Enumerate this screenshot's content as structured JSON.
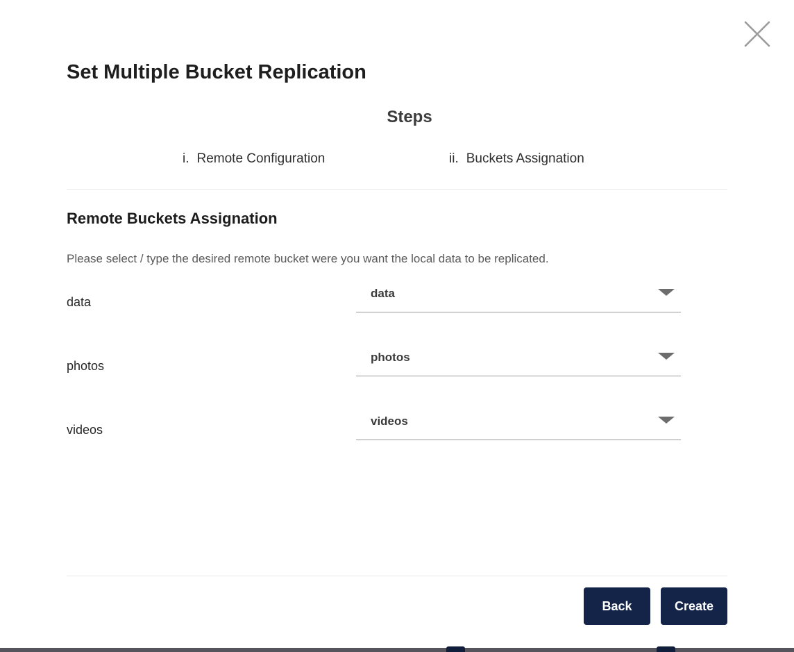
{
  "modal": {
    "title": "Set Multiple Bucket Replication",
    "steps": {
      "heading": "Steps",
      "items": [
        {
          "marker": "i.",
          "label": "Remote Configuration"
        },
        {
          "marker": "ii.",
          "label": "Buckets Assignation"
        }
      ]
    },
    "section": {
      "heading": "Remote Buckets Assignation",
      "description": "Please select / type the desired remote bucket were you want the local data to be replicated."
    },
    "bucket_rows": [
      {
        "local_bucket": "data",
        "remote_bucket": "data"
      },
      {
        "local_bucket": "photos",
        "remote_bucket": "photos"
      },
      {
        "local_bucket": "videos",
        "remote_bucket": "videos"
      }
    ],
    "footer": {
      "back_label": "Back",
      "create_label": "Create"
    }
  },
  "icons": {
    "close": "x-icon",
    "select_arrow": "triangle-down-icon"
  },
  "colors": {
    "button_bg": "#132448",
    "divider": "#e9e9e9",
    "select_underline": "#999999",
    "close_icon": "#9b9b9b",
    "arrow_icon": "#6d6d6d",
    "bottom_strip": "#55545c",
    "bottom_bump": "#101e3c"
  }
}
